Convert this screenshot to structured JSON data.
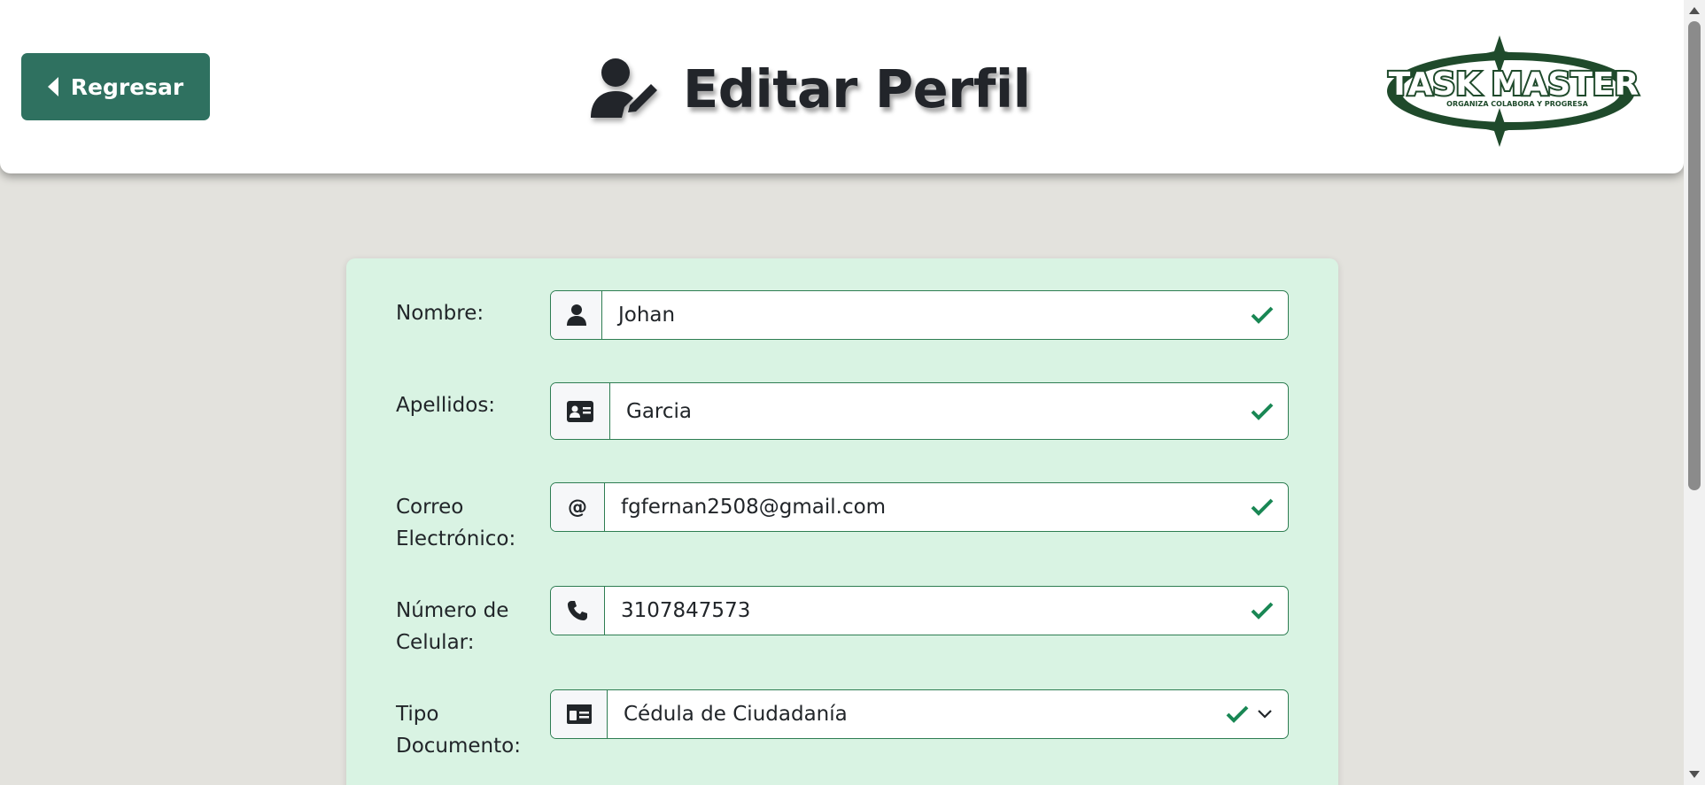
{
  "header": {
    "back_label": "Regresar",
    "title": "Editar Perfil",
    "logo_text": "TASK MASTER",
    "logo_tagline": "ORGANIZA COLABORA Y PROGRESA"
  },
  "colors": {
    "brand_green": "#2f7160",
    "valid_green": "#198754",
    "card_bg": "#d9f3e3",
    "page_bg": "#e3e2dd"
  },
  "form": {
    "fields": [
      {
        "label": "Nombre:",
        "value": "Johan",
        "icon": "user-icon"
      },
      {
        "label": "Apellidos:",
        "value": "Garcia",
        "icon": "id-card-icon"
      },
      {
        "label": "Correo Electrónico:",
        "value": "fgfernan2508@gmail.com",
        "icon": "at-icon"
      },
      {
        "label": "Número de Celular:",
        "value": "3107847573",
        "icon": "phone-icon"
      },
      {
        "label": "Tipo Documento:",
        "value": "Cédula de Ciudadanía",
        "icon": "id-card-icon",
        "type": "select"
      }
    ]
  }
}
